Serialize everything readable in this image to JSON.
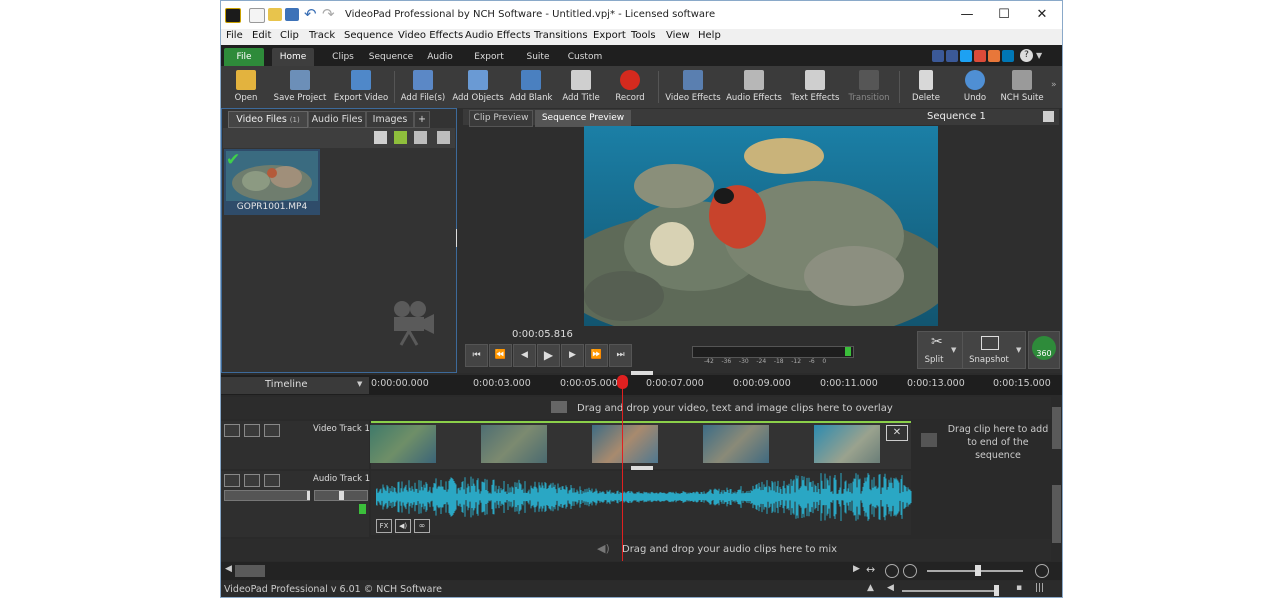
{
  "window": {
    "title": "VideoPad Professional by NCH Software - Untitled.vpj* - Licensed software",
    "controls": {
      "minimize": "—",
      "maximize": "☐",
      "close": "✕"
    }
  },
  "menu": [
    "File",
    "Edit",
    "Clip",
    "Track",
    "Sequence",
    "Video Effects",
    "Audio Effects",
    "Transitions",
    "Export",
    "Tools",
    "View",
    "Help"
  ],
  "ribbon_tabs": [
    "File",
    "Home",
    "Clips",
    "Sequence",
    "Audio",
    "Export",
    "Suite",
    "Custom"
  ],
  "toolbar": [
    {
      "label": "Open",
      "icon": "folder-icon"
    },
    {
      "label": "Save Project",
      "icon": "save-icon"
    },
    {
      "label": "Export Video",
      "icon": "export-video-icon"
    },
    {
      "label": "Add File(s)",
      "icon": "add-files-icon"
    },
    {
      "label": "Add Objects",
      "icon": "add-objects-icon"
    },
    {
      "label": "Add Blank",
      "icon": "add-blank-icon"
    },
    {
      "label": "Add Title",
      "icon": "add-title-icon"
    },
    {
      "label": "Record",
      "icon": "record-icon"
    },
    {
      "label": "Video Effects",
      "icon": "video-effects-icon"
    },
    {
      "label": "Audio Effects",
      "icon": "audio-effects-icon"
    },
    {
      "label": "Text Effects",
      "icon": "text-effects-icon"
    },
    {
      "label": "Transition",
      "icon": "transition-icon"
    },
    {
      "label": "Delete",
      "icon": "trash-icon"
    },
    {
      "label": "Undo",
      "icon": "undo-icon"
    },
    {
      "label": "NCH Suite",
      "icon": "nch-suite-icon"
    }
  ],
  "bin": {
    "tabs": [
      "Video Files",
      "Audio Files",
      "Images",
      "+"
    ],
    "video_files_count": "(1)",
    "file_name": "GOPR1001.MP4"
  },
  "preview": {
    "tabs": [
      "Clip Preview",
      "Sequence Preview"
    ],
    "title": "Sequence 1",
    "timecode": "0:00:05.816",
    "meter_labels": [
      "-42",
      "-36",
      "-30",
      "-24",
      "-18",
      "-12",
      "-6",
      "0"
    ],
    "split_label": "Split",
    "snapshot_label": "Snapshot",
    "vr_label": "360"
  },
  "timeline": {
    "label": "Timeline",
    "ruler": [
      "0:00:00.000",
      "0:00:03.000",
      "0:00:05.000",
      "0:00:07.000",
      "0:00:09.000",
      "0:00:11.000",
      "0:00:13.000",
      "0:00:15.000"
    ],
    "overlay_hint": "Drag and drop your video, text and image clips here to overlay",
    "video_track": "Video Track 1",
    "audio_track": "Audio Track 1",
    "drag_end_hint": "Drag clip here to add to end of the sequence",
    "audio_hint": "Drag and drop your audio clips here to mix"
  },
  "status": "VideoPad Professional v 6.01 © NCH Software",
  "colors": {
    "accent_green": "#2e8b3a",
    "waveform": "#2aa7c4",
    "playhead": "#e02020"
  }
}
